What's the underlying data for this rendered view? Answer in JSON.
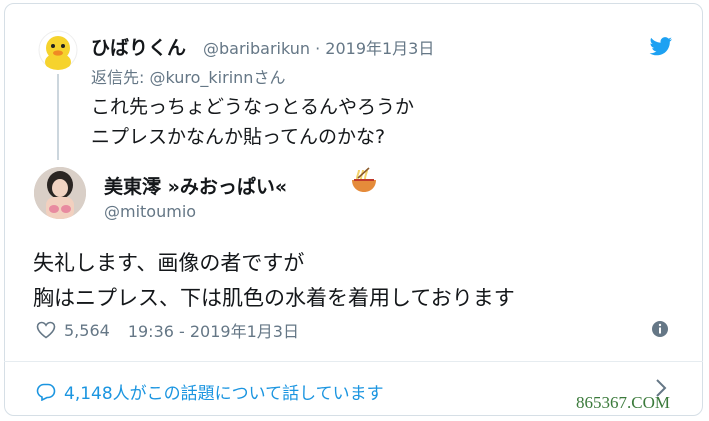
{
  "parent": {
    "name": "ひばりくん",
    "handle": "@baribarikun · 2019年1月3日",
    "reply_prefix": "返信先: ",
    "reply_to": "@kuro_kirinn",
    "reply_suffix": "さん",
    "lines": [
      "これ先っちょどうなっとるんやろうか",
      "ニプレスかなんか貼ってんのかな?"
    ]
  },
  "main": {
    "name": "美東澪 »みおっぱい«",
    "handle": "@mitoumio",
    "lines": [
      "失礼します、画像の者ですが",
      "胸はニプレス、下は肌色の水着を着用しております"
    ],
    "likes": "5,564",
    "timestamp": "19:36 - 2019年1月3日"
  },
  "footer": {
    "text": "4,148人がこの話題について話しています"
  },
  "watermark": "865367.COM",
  "colors": {
    "twitter_blue": "#1da1f2",
    "link": "#1b95e0",
    "secondary": "#657786",
    "border": "#d6dfe6"
  },
  "icons": [
    "duck-avatar",
    "twitter-bird-icon",
    "ramen-icon",
    "heart-icon",
    "info-icon",
    "speech-bubble-icon",
    "chevron-right-icon"
  ]
}
